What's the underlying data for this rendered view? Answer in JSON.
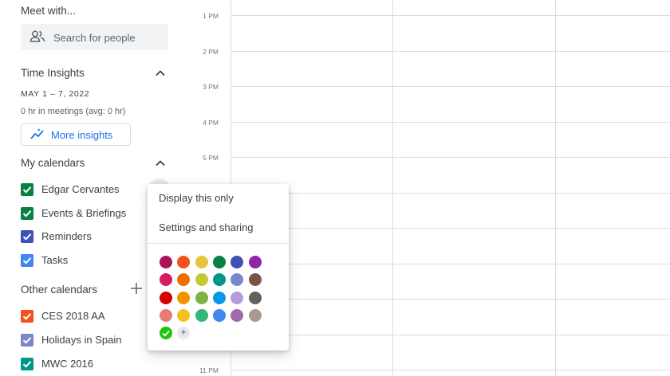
{
  "meet_with": {
    "title": "Meet with...",
    "search_placeholder": "Search for people"
  },
  "time_insights": {
    "title": "Time Insights",
    "date_range": "MAY 1 – 7, 2022",
    "summary": "0 hr in meetings (avg: 0 hr)",
    "button_label": "More insights"
  },
  "my_calendars": {
    "title": "My calendars",
    "items": [
      {
        "label": "Edgar Cervantes",
        "color": "#0b8043"
      },
      {
        "label": "Events & Briefings",
        "color": "#0b8043"
      },
      {
        "label": "Reminders",
        "color": "#3f51b5"
      },
      {
        "label": "Tasks",
        "color": "#4285f4"
      }
    ]
  },
  "other_calendars": {
    "title": "Other calendars",
    "items": [
      {
        "label": "CES 2018 AA",
        "color": "#f4511e"
      },
      {
        "label": "Holidays in Spain",
        "color": "#7986cb"
      },
      {
        "label": "MWC 2016",
        "color": "#009688"
      }
    ]
  },
  "time_labels": [
    "1 PM",
    "2 PM",
    "3 PM",
    "4 PM",
    "5 PM",
    "11 PM"
  ],
  "context_menu": {
    "items": [
      "Display this only",
      "Settings and sharing"
    ],
    "color_rows": [
      [
        "#ad1457",
        "#f4511e",
        "#e4c441",
        "#0b8043",
        "#3f51b5",
        "#8e24aa"
      ],
      [
        "#d81b60",
        "#ef6c00",
        "#c0ca33",
        "#009688",
        "#7986cb",
        "#795548"
      ],
      [
        "#d50000",
        "#f09300",
        "#7cb342",
        "#039be5",
        "#b39ddb",
        "#616161"
      ],
      [
        "#e67c73",
        "#f6bf26",
        "#33b679",
        "#4285f4",
        "#9e69af",
        "#a79b8e"
      ]
    ],
    "selected_color": "#1fc20c",
    "add_color_symbol": "+"
  }
}
